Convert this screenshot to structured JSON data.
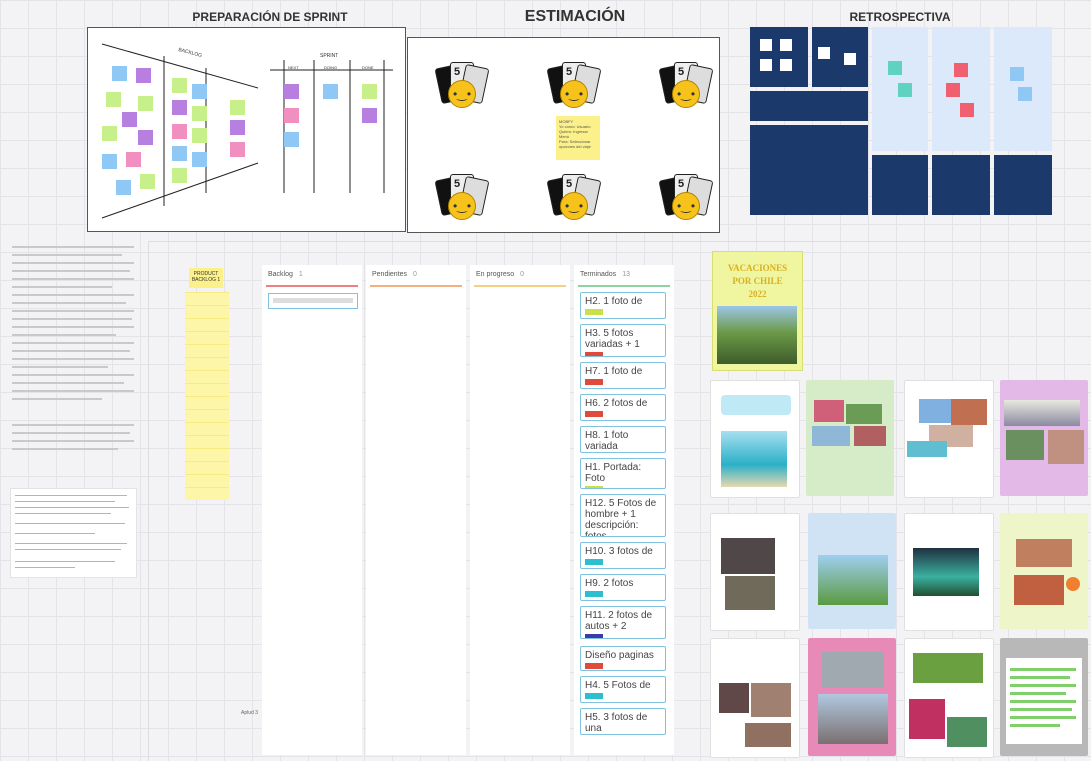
{
  "sections": {
    "sprint_prep_title": "PREPARACIÓN DE SPRINT",
    "estimation_title": "ESTIMACIÓN",
    "retro_title": "RETROSPECTIVA"
  },
  "sprint_prep": {
    "labels": [
      "BACKLOG",
      "SPRINT"
    ],
    "sprint_cols": [
      "NEXT",
      "DOING",
      "DONE"
    ]
  },
  "estimation": {
    "card_number": "5",
    "note_lines": [
      "MOBFY",
      "Yo como: Usuario",
      "Quiero: Ingresar",
      "Menú",
      "Para: Seleccionar",
      "opciones del viaje"
    ]
  },
  "product_backlog_label": [
    "PRODUCT",
    "BACKLOG 1"
  ],
  "kanban": {
    "columns": [
      {
        "name": "Backlog",
        "count": "1"
      },
      {
        "name": "Pendientes",
        "count": "0"
      },
      {
        "name": "En progreso",
        "count": "0"
      },
      {
        "name": "Terminados",
        "count": "13"
      }
    ],
    "done_cards": [
      {
        "text": "H2. 1 foto de",
        "color": "#c8e04a"
      },
      {
        "text": "H3. 5 fotos variadas + 1",
        "color": "#e04a3a"
      },
      {
        "text": "H7. 1 foto de",
        "color": "#e04a3a"
      },
      {
        "text": "H6. 2 fotos de",
        "color": "#e04a3a"
      },
      {
        "text": "H8. 1 foto variada",
        "color": "#e04a3a"
      },
      {
        "text": "H1. Portada: Foto",
        "color": "#c8e04a"
      },
      {
        "text": "H12. 5 Fotos de hombre + 1 descripción: fotos",
        "color": "#c8e04a"
      },
      {
        "text": "H10. 3 fotos de",
        "color": "#2bbfd0"
      },
      {
        "text": "H9. 2 fotos",
        "color": "#2bbfd0"
      },
      {
        "text": "H11. 2 fotos de autos + 2",
        "color": "#3a3aa8"
      },
      {
        "text": "Diseño paginas",
        "color": "#e04a3a"
      },
      {
        "text": "H4. 5 Fotos de",
        "color": "#2bbfd0"
      },
      {
        "text": "H5. 3 fotos de una",
        "color": "#2bbfd0"
      }
    ]
  },
  "cover": {
    "title_lines": [
      "VACACIONES",
      "POR CHILE",
      "2022"
    ]
  },
  "canvas_label": "Aplud 3",
  "colors": {
    "sticky_blue": "#8fc8f5",
    "sticky_purple": "#b77fe0",
    "sticky_green": "#c7f08a",
    "sticky_pink": "#f08fc0",
    "sticky_yellow": "#fbf08a",
    "navy": "#1b3a6b",
    "teal": "#5fd3c0",
    "red": "#f06070"
  }
}
